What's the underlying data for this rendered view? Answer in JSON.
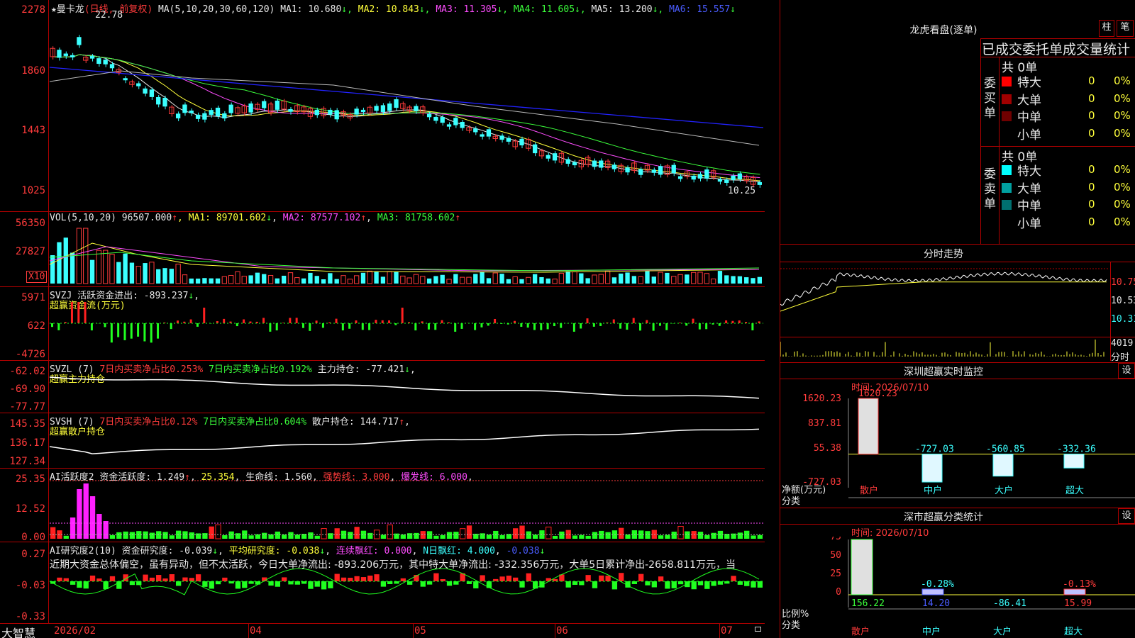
{
  "app": {
    "name": "大智慧"
  },
  "main": {
    "stock_name": "曼卡龙",
    "period": "(日线, 前复权)",
    "ma_header": "MA(5,10,20,30,60,120)",
    "ma": [
      {
        "label": "MA1: 10.680",
        "arrow": "↓",
        "color": "#e8e8e8"
      },
      {
        "label": "MA2: 10.843",
        "arrow": "↓",
        "color": "#ffff3b"
      },
      {
        "label": "MA3: 11.305",
        "arrow": "↓",
        "color": "#ff4dff"
      },
      {
        "label": "MA4: 11.605",
        "arrow": "↓",
        "color": "#3bff3b"
      },
      {
        "label": "MA5: 13.200",
        "arrow": "↓",
        "color": "#e8e8e8"
      },
      {
        "label": "MA6: 15.557",
        "arrow": "↓",
        "color": "#4a5cff"
      }
    ],
    "high_label": "22.78",
    "low_label": "10.25",
    "y_ticks": [
      "2278",
      "1860",
      "1443",
      "1025"
    ]
  },
  "volume": {
    "header": "VOL(5,10,20)",
    "value": "96507.000",
    "ma1": "MA1: 89701.602",
    "ma2": "MA2: 87577.102",
    "ma3": "MA3: 81758.602",
    "y_ticks": [
      "56350",
      "27827"
    ],
    "unit": "X10"
  },
  "svzj": {
    "header": "SVZJ  活跃资金进出: -893.237",
    "subtitle": "超赢资金流(万元)",
    "y_ticks": [
      "5971",
      "622",
      "-4726"
    ]
  },
  "svzl": {
    "header": "SVZL (7)",
    "t1": "7日内买卖净占比0.253%",
    "t2": "7日内买卖净占比0.192%",
    "t3": "主力持仓: -77.421",
    "subtitle": "超赢主力持仓",
    "y_ticks": [
      "-62.02",
      "-69.90",
      "-77.77"
    ]
  },
  "svsh": {
    "header": "SVSH (7)",
    "t1": "7日内买卖净占比0.12%",
    "t2": "7日内买卖净占比0.604%",
    "t3": "散户持仓: 144.717",
    "subtitle": "超赢散户持仓",
    "y_ticks": [
      "145.35",
      "136.17",
      "127.34"
    ]
  },
  "ai_active": {
    "header": "AI活跃度2",
    "t1": "资金活跃度: 1.249",
    "t2": "25.354",
    "t3": "生命线: 1.560",
    "t4": "强势线: 3.000",
    "t5": "爆发线: 6.000",
    "y_ticks": [
      "25.35",
      "12.52",
      "0.00"
    ]
  },
  "ai_research": {
    "header": "AI研究度2(10)",
    "t1": "资金研究度: -0.039",
    "t2": "平均研究度: -0.038",
    "t3": "连续飘红: 0.000",
    "t4": "N日飘红: 4.000",
    "t5": "-0.038",
    "commentary": "近期大资金总体偏空，虽有异动，但不太活跃，今日大单净流出: -893.206万元，其中特大单净流出: -332.356万元，大单5日累计净出-2658.811万元，当",
    "y_ticks": [
      "0.27",
      "-0.03",
      "-0.33"
    ]
  },
  "x_axis": [
    "2026/02",
    "04",
    "05",
    "06",
    "07"
  ],
  "dragon_tiger": {
    "title": "龙虎看盘(逐单)",
    "btn_col": "柱",
    "btn_pen": "笔",
    "subtitle": "已成交委托单成交量统计",
    "buy_label": "委买单",
    "sell_label": "委卖单",
    "buy_total": "共 0单",
    "sell_total": "共 0单",
    "buy_rows": [
      {
        "name": "特大",
        "count": "0",
        "pct": "0%",
        "color": "#ff0000"
      },
      {
        "name": "大单",
        "count": "0",
        "pct": "0%",
        "color": "#a00000"
      },
      {
        "name": "中单",
        "count": "0",
        "pct": "0%",
        "color": "#700000"
      },
      {
        "name": "小单",
        "count": "0",
        "pct": "0%",
        "color": ""
      }
    ],
    "sell_rows": [
      {
        "name": "特大",
        "count": "0",
        "pct": "0%",
        "color": "#00ffff"
      },
      {
        "name": "大单",
        "count": "0",
        "pct": "0%",
        "color": "#00a0a0"
      },
      {
        "name": "中单",
        "count": "0",
        "pct": "0%",
        "color": "#007070"
      },
      {
        "name": "小单",
        "count": "0",
        "pct": "0%",
        "color": ""
      }
    ]
  },
  "intraday": {
    "title": "分时走势",
    "y_ticks": [
      "10.75",
      "10.53",
      "10.31"
    ],
    "vol_tick": "4019",
    "vol_label": "分时"
  },
  "sz_monitor": {
    "title": "深圳超赢实时监控",
    "btn": "设",
    "time": "时间: 2026/07/10",
    "y_ticks": [
      "1620.23",
      "837.81",
      "55.38",
      "-727.03"
    ],
    "y_label1": "净额(万元)",
    "y_label2": "分类",
    "categories": [
      "散户",
      "中户",
      "大户",
      "超大"
    ],
    "values": [
      1620.23,
      -727.03,
      -560.85,
      -332.36
    ],
    "value_labels": [
      "1620.23",
      "-727.03",
      "-560.85",
      "-332.36"
    ]
  },
  "sz_category": {
    "title": "深市超赢分类统计",
    "btn": "设",
    "time": "时间: 2026/07/10",
    "y_ticks": [
      "75",
      "50",
      "25",
      "0"
    ],
    "y_label1": "比例%",
    "y_label2": "分类",
    "categories": [
      "散户",
      "中户",
      "大户",
      "超大"
    ],
    "bar_pct": [
      75,
      0.28,
      0,
      0.13
    ],
    "bar_labels": [
      "",
      "-0.28%",
      "",
      "-0.13%"
    ],
    "values": [
      "156.22",
      "14.20",
      "-86.41",
      "15.99"
    ]
  }
}
